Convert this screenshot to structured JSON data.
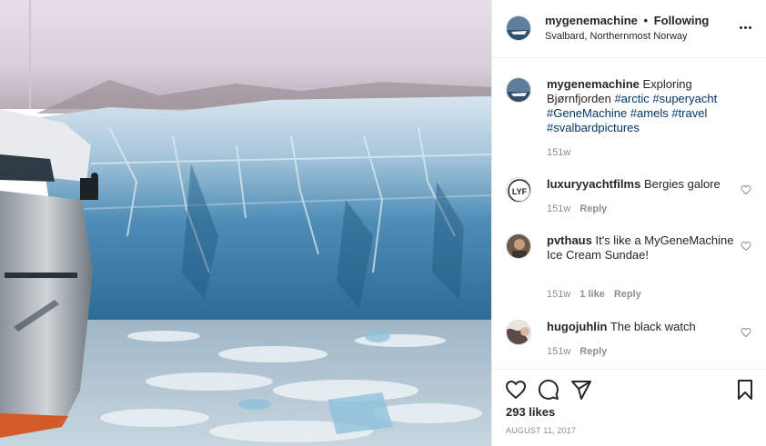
{
  "post": {
    "image_alt": "Yacht beside a blue glacier wall in Bjørnfjorden, Svalbard",
    "header": {
      "username": "mygenemachine",
      "separator": "•",
      "follow_status": "Following",
      "location": "Svalbard, Northernmost Norway"
    },
    "caption": {
      "username": "mygenemachine",
      "text": "Exploring Bjørnfjorden",
      "hashtags": [
        "#arctic",
        "#superyacht",
        "#GeneMachine",
        "#amels",
        "#travel",
        "#svalbardpictures"
      ],
      "age": "151w"
    },
    "comments": [
      {
        "username": "luxuryyachtfilms",
        "text": "Bergies galore",
        "age": "151w",
        "likes": "",
        "reply": "Reply"
      },
      {
        "username": "pvthaus",
        "text": "It's like a MyGeneMachine Ice Cream Sundae!",
        "age": "151w",
        "likes": "1 like",
        "reply": "Reply"
      },
      {
        "username": "hugojuhlin",
        "text": "The black watch",
        "age": "151w",
        "likes": "",
        "reply": "Reply"
      }
    ],
    "likes": "293 likes",
    "date": "AUGUST 11, 2017"
  },
  "icons": {
    "more": "more-options-icon",
    "like": "heart-icon",
    "comment": "comment-icon",
    "share": "share-icon",
    "save": "bookmark-icon"
  },
  "colors": {
    "text": "#262626",
    "muted": "#8e8e8e",
    "hashtag": "#00376b",
    "divider": "#efefef"
  }
}
